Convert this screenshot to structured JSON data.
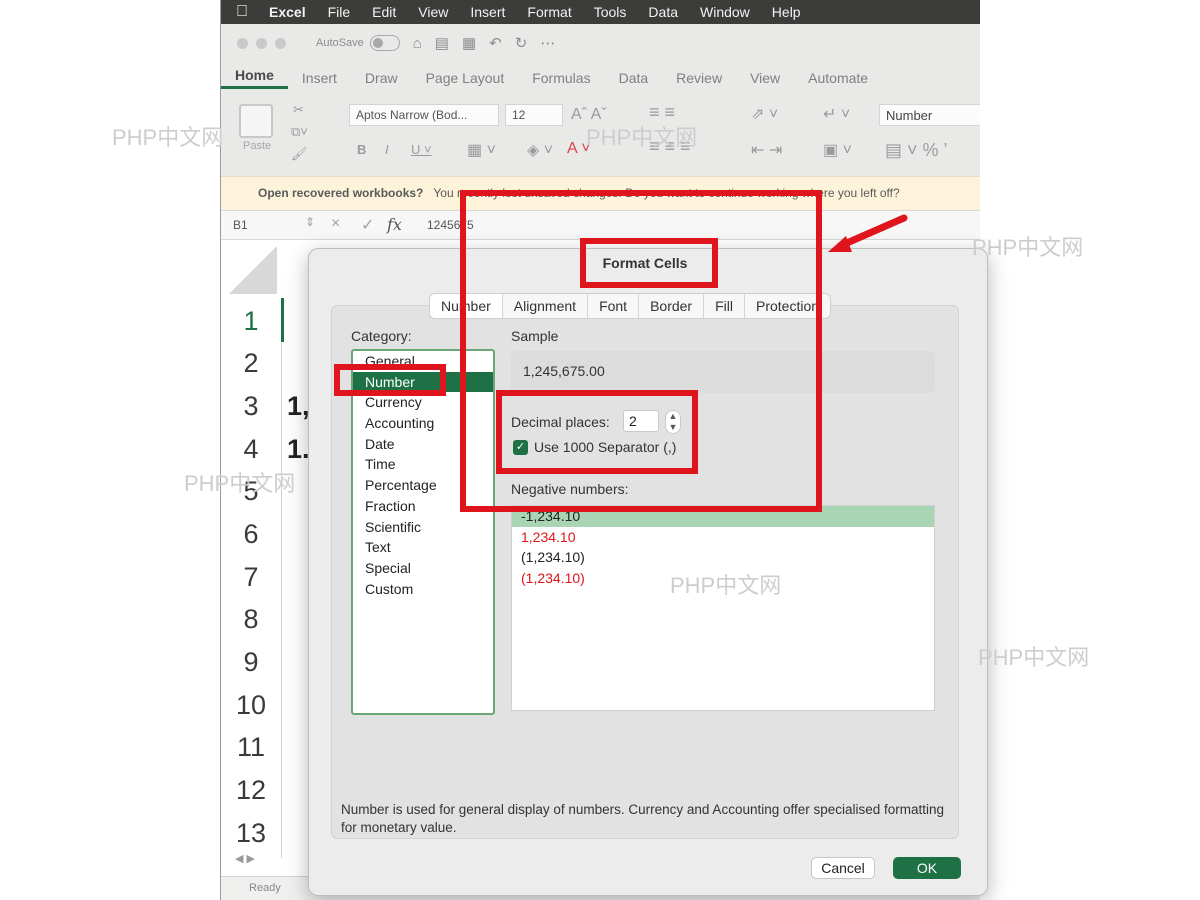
{
  "menubar": {
    "app": "Excel",
    "items": [
      "File",
      "Edit",
      "View",
      "Insert",
      "Format",
      "Tools",
      "Data",
      "Window",
      "Help"
    ]
  },
  "titlebar": {
    "autosave": "AutoSave"
  },
  "ribbon": {
    "tabs": [
      "Home",
      "Insert",
      "Draw",
      "Page Layout",
      "Formulas",
      "Data",
      "Review",
      "View",
      "Automate"
    ],
    "font": "Aptos Narrow (Bod...",
    "size": "12",
    "paste": "Paste",
    "number_format": "Number"
  },
  "infobar": {
    "text": "Open recovered workbooks?",
    "rest": "You recently lost unsaved changes. Do you want to continue working where you left off?"
  },
  "formula": {
    "cell": "B1",
    "value": "1245675"
  },
  "grid": {
    "rows": [
      "1",
      "2",
      "3",
      "4",
      "5",
      "6",
      "7",
      "8",
      "9",
      "10",
      "11",
      "12",
      "13"
    ],
    "peek3": "1,",
    "peek4": "1."
  },
  "status": {
    "ready": "Ready"
  },
  "dialog": {
    "title": "Format Cells",
    "tabs": [
      "Number",
      "Alignment",
      "Font",
      "Border",
      "Fill",
      "Protection"
    ],
    "category_label": "Category:",
    "categories": [
      "General",
      "Number",
      "Currency",
      "Accounting",
      "Date",
      "Time",
      "Percentage",
      "Fraction",
      "Scientific",
      "Text",
      "Special",
      "Custom"
    ],
    "sample_label": "Sample",
    "sample_value": "1,245,675.00",
    "decimal_label": "Decimal places:",
    "decimal_value": "2",
    "separator_label": "Use 1000 Separator (,)",
    "negative_label": "Negative numbers:",
    "negative_options": [
      "-1,234.10",
      "1,234.10",
      "(1,234.10)",
      "(1,234.10)"
    ],
    "description": "Number is used for general display of numbers.  Currency and Accounting offer specialised formatting for monetary value.",
    "cancel": "Cancel",
    "ok": "OK"
  },
  "watermarks": [
    "PHP中文网",
    "PHP中文网",
    "PHP中文网",
    "PHP中文网",
    "PHP中文网",
    "PHP中文网"
  ],
  "colors": {
    "accent": "#1e7145",
    "highlight": "#e0141c",
    "negative_red": "#e0141c"
  }
}
